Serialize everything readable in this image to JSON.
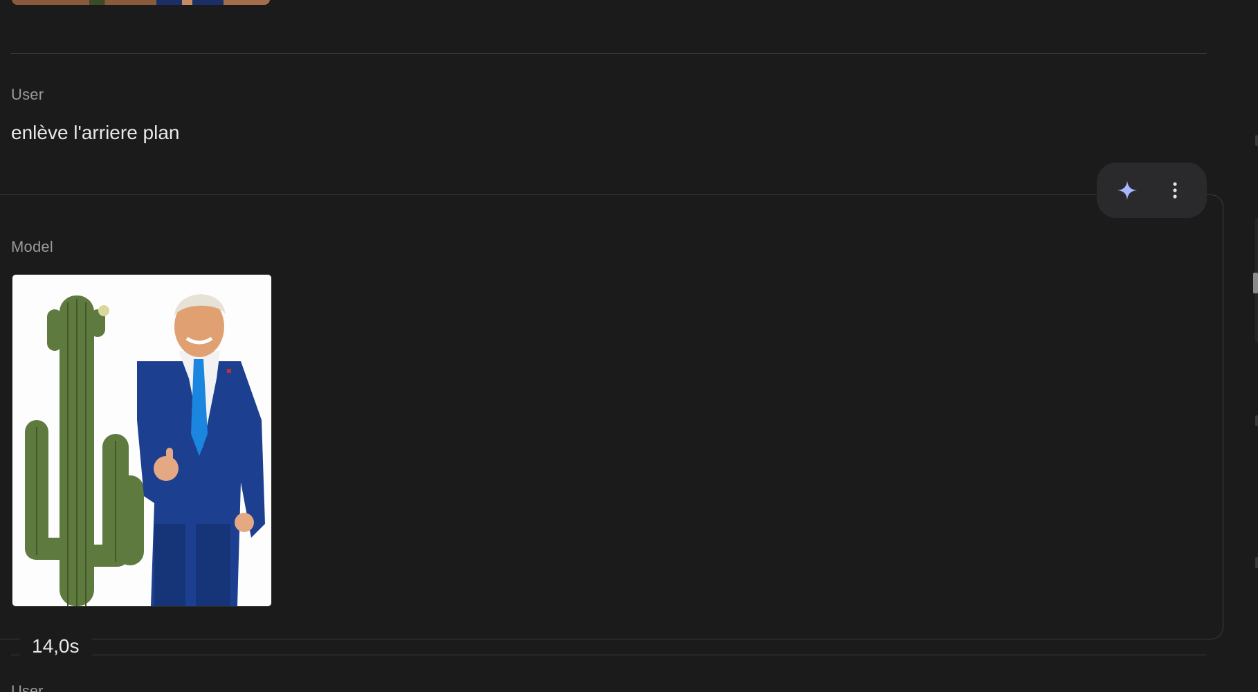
{
  "conversation": {
    "user_turn": {
      "role_label": "User",
      "message": "enlève l'arriere plan"
    },
    "model_turn": {
      "role_label": "Model",
      "image_alt": "Man in blue suit giving thumbs up next to a saguaro cactus, background removed",
      "elapsed_time": "14,0s"
    },
    "next_turn": {
      "role_label": "User"
    }
  },
  "actions": {
    "sparkle_icon": "sparkle-icon",
    "more_icon": "more-vert-icon"
  },
  "colors": {
    "background": "#1b1b1c",
    "accent_sparkle": "#a8b8ff",
    "panel_border": "#3c3c3e",
    "suit": "#1c3f8f",
    "tie": "#1a86e0",
    "cactus": "#5f7a3e"
  }
}
